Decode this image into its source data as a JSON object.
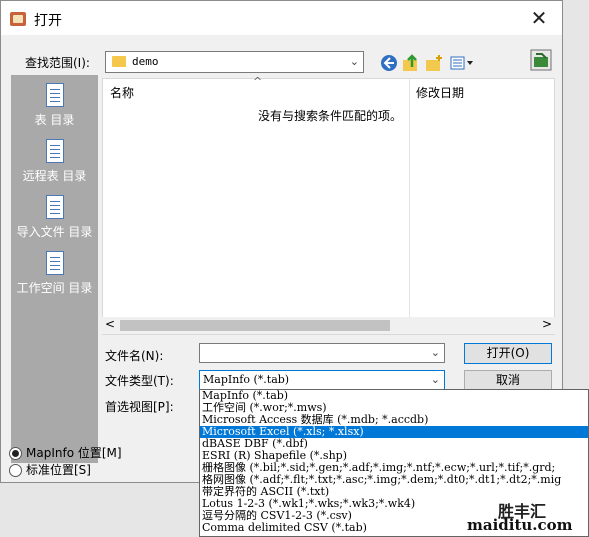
{
  "window": {
    "title": "打开",
    "close_label": "✕"
  },
  "lookin": {
    "label": "查找范围(I):",
    "value": "demo"
  },
  "places": [
    {
      "label": "表 目录"
    },
    {
      "label": "远程表 目录"
    },
    {
      "label": "导入文件 目录"
    },
    {
      "label": "工作空间 目录"
    }
  ],
  "filelist": {
    "col_name": "名称",
    "col_modified": "修改日期",
    "empty_message": "没有与搜索条件匹配的项。",
    "scroll_left": "<",
    "scroll_right": ">"
  },
  "filename": {
    "label": "文件名(N):",
    "value": ""
  },
  "filetype": {
    "label": "文件类型(T):",
    "value": "MapInfo (*.tab)"
  },
  "preferred_view": {
    "label": "首选视图[P]:"
  },
  "buttons": {
    "open": "打开(O)",
    "cancel": "取消"
  },
  "location": {
    "mapinfo": "MapInfo 位置[M]",
    "standard": "标准位置[S]"
  },
  "dropdown_options": [
    "MapInfo (*.tab)",
    "工作空间 (*.wor;*.mws)",
    "Microsoft Access 数据库 (*.mdb; *.accdb)",
    "Microsoft Excel (*.xls; *.xlsx)",
    "dBASE DBF (*.dbf)",
    "ESRI (R) Shapefile (*.shp)",
    "栅格图像 (*.bil;*.sid;*.gen;*.adf;*.img;*.ntf;*.ecw;*.url;*.tif;*.grd;",
    "格网图像 (*.adf;*.flt;*.txt;*.asc;*.img;*.dem;*.dt0;*.dt1;*.dt2;*.mig",
    "带定界符的 ASCII (*.txt)",
    "Lotus 1-2-3 (*.wk1;*.wks;*.wk3;*.wk4)",
    "逗号分隔的 CSV1-2-3 (*.csv)",
    "Comma delimited CSV (*.tab)"
  ],
  "dropdown_selected_index": 3,
  "watermark": {
    "line1": "胜丰汇",
    "line2": "maiditu.com"
  }
}
